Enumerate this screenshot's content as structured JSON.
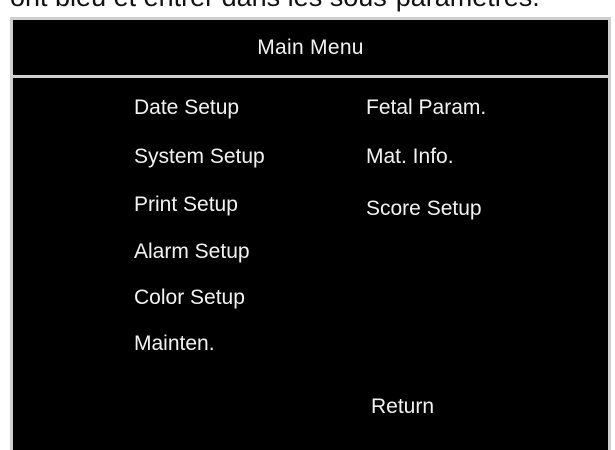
{
  "caption": "ont bleu et entrer dans les sous-paramètres.",
  "menu": {
    "title": "Main Menu",
    "left_items": [
      "Date Setup",
      "System Setup",
      "Print Setup",
      "Alarm Setup",
      "Color Setup",
      "Mainten."
    ],
    "right_items": [
      "Fetal Param.",
      "Mat. Info.",
      "Score Setup"
    ],
    "return_label": "Return"
  },
  "colors": {
    "screen_background": "#000000",
    "text": "#f2f2f2",
    "frame": "#cfcfcf"
  }
}
